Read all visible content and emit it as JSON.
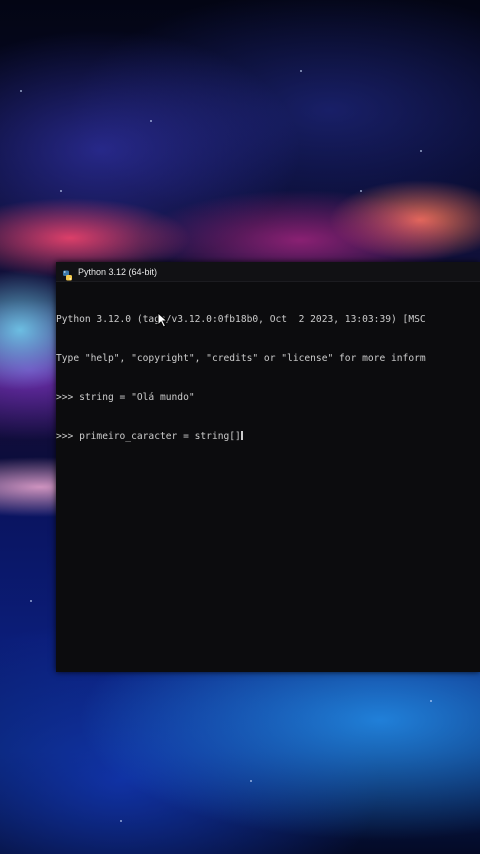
{
  "window": {
    "title": "Python 3.12 (64-bit)",
    "icon": "python-icon"
  },
  "terminal": {
    "lines": [
      "Python 3.12.0 (tags/v3.12.0:0fb18b0, Oct  2 2023, 13:03:39) [MSC",
      "Type \"help\", \"copyright\", \"credits\" or \"license\" for more inform",
      ">>> string = \"Olá mundo\"",
      ">>> primeiro_caracter = string[]"
    ]
  },
  "colors": {
    "console_background": "#0c0c0e",
    "console_text": "#cccccc"
  }
}
